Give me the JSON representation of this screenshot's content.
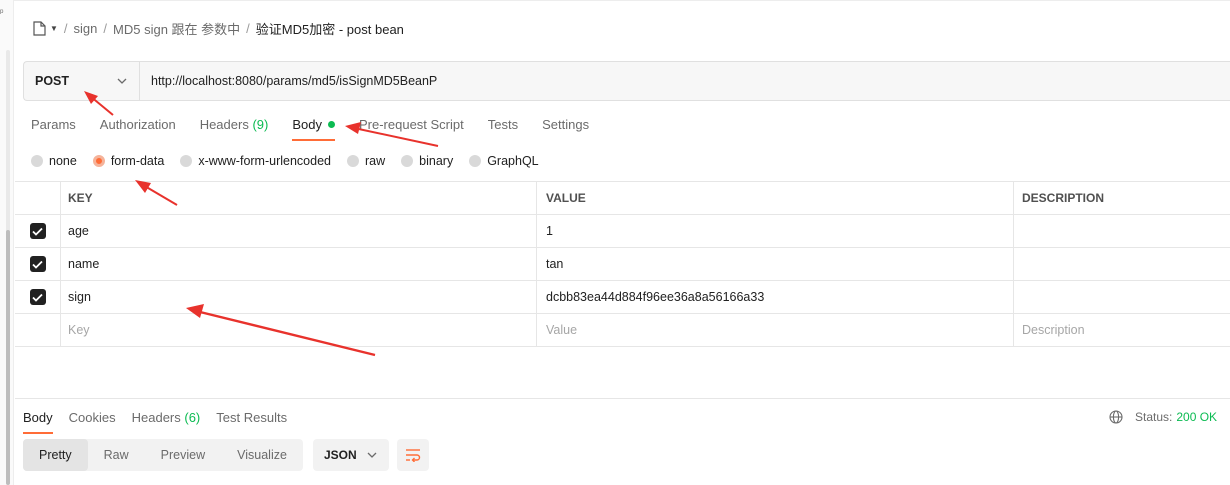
{
  "breadcrumb": {
    "items": [
      "sign",
      "MD5 sign 跟在 参数中"
    ],
    "current": "验证MD5加密 - post bean",
    "separator": "/"
  },
  "request": {
    "method": "POST",
    "url": "http://localhost:8080/params/md5/isSignMD5BeanP"
  },
  "request_tabs": [
    {
      "label": "Params"
    },
    {
      "label": "Authorization"
    },
    {
      "label": "Headers",
      "count": "(9)"
    },
    {
      "label": "Body"
    },
    {
      "label": "Pre-request Script"
    },
    {
      "label": "Tests"
    },
    {
      "label": "Settings"
    }
  ],
  "body_types": [
    {
      "label": "none",
      "selected": false
    },
    {
      "label": "form-data",
      "selected": true
    },
    {
      "label": "x-www-form-urlencoded",
      "selected": false
    },
    {
      "label": "raw",
      "selected": false
    },
    {
      "label": "binary",
      "selected": false
    },
    {
      "label": "GraphQL",
      "selected": false
    }
  ],
  "params_table": {
    "headers": {
      "key": "KEY",
      "value": "VALUE",
      "description": "DESCRIPTION"
    },
    "rows": [
      {
        "key": "age",
        "value": "1",
        "checked": true
      },
      {
        "key": "name",
        "value": "tan",
        "checked": true
      },
      {
        "key": "sign",
        "value": "dcbb83ea44d884f96ee36a8a56166a33",
        "checked": true
      }
    ],
    "placeholders": {
      "key": "Key",
      "value": "Value",
      "description": "Description"
    }
  },
  "response_tabs": [
    {
      "label": "Body"
    },
    {
      "label": "Cookies"
    },
    {
      "label": "Headers",
      "count": "(6)"
    },
    {
      "label": "Test Results"
    }
  ],
  "status": {
    "label": "Status:",
    "code": "200 OK"
  },
  "view_modes": [
    "Pretty",
    "Raw",
    "Preview",
    "Visualize"
  ],
  "format": "JSON",
  "colors": {
    "accent": "#ff6c37",
    "success": "#0cbb52",
    "annotation": "#e8322c"
  }
}
